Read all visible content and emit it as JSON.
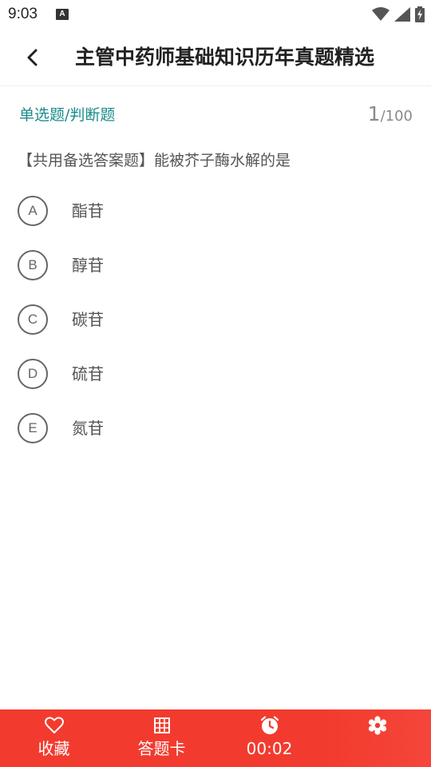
{
  "status_bar": {
    "time": "9:03",
    "notification_glyph": "A",
    "icons": [
      "wifi-icon",
      "signal-icon",
      "battery-charging-icon"
    ]
  },
  "header": {
    "back_icon": "chevron-left-icon",
    "title": "主管中药师基础知识历年真题精选"
  },
  "question": {
    "type_label": "单选题/判断题",
    "current": "1",
    "total": "/100",
    "text": "【共用备选答案题】能被芥子酶水解的是",
    "options": [
      {
        "letter": "A",
        "text": "酯苷"
      },
      {
        "letter": "B",
        "text": "醇苷"
      },
      {
        "letter": "C",
        "text": "碳苷"
      },
      {
        "letter": "D",
        "text": "硫苷"
      },
      {
        "letter": "E",
        "text": "氮苷"
      }
    ]
  },
  "bottom_bar": {
    "background": "#f23b2e",
    "favorite_label": "收藏",
    "answer_card_label": "答题卡",
    "timer": "00:02",
    "icons": [
      "heart-icon",
      "grid-icon",
      "clock-icon",
      "gear-icon"
    ]
  },
  "colors": {
    "accent_teal": "#1b8b8b",
    "bottom_red": "#f23b2e"
  }
}
